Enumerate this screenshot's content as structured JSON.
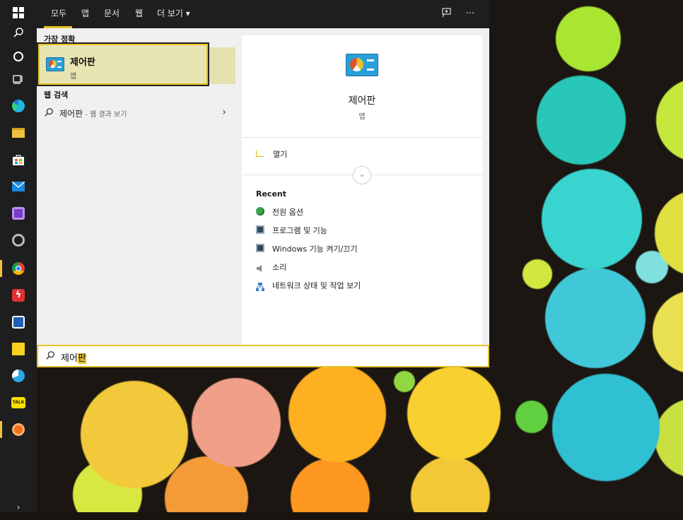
{
  "taskbar": {
    "items": [
      {
        "name": "windows-start",
        "icon": "windows-logo-icon"
      },
      {
        "name": "search",
        "icon": "search-icon"
      },
      {
        "name": "cortana",
        "icon": "cortana-circle-icon"
      },
      {
        "name": "task-view",
        "icon": "task-view-icon"
      },
      {
        "name": "edge",
        "icon": "edge-browser-icon"
      },
      {
        "name": "file-explorer",
        "icon": "folder-icon"
      },
      {
        "name": "store",
        "icon": "store-bag-icon"
      },
      {
        "name": "mail",
        "icon": "mail-envelope-icon"
      },
      {
        "name": "app-purple",
        "icon": "chip-app-icon"
      },
      {
        "name": "app-recorder",
        "icon": "record-circle-icon"
      },
      {
        "name": "chrome",
        "icon": "chrome-browser-icon",
        "active": true
      },
      {
        "name": "app-flash",
        "icon": "lightning-app-icon"
      },
      {
        "name": "app-calendar",
        "icon": "calendar-grid-icon"
      },
      {
        "name": "sticky-notes",
        "icon": "sticky-note-icon"
      },
      {
        "name": "app-bird",
        "icon": "bird-app-icon"
      },
      {
        "name": "kakaotalk",
        "icon": "talk-bubble-icon",
        "label": "TALK"
      },
      {
        "name": "app-location",
        "icon": "location-pin-icon",
        "active": true
      },
      {
        "name": "expand",
        "icon": "chevron-right-icon"
      }
    ],
    "colors": {
      "accent": "#f0c040"
    }
  },
  "navbar": {
    "tabs": [
      {
        "label": "모두",
        "active": true
      },
      {
        "label": "앱"
      },
      {
        "label": "문서"
      },
      {
        "label": "웹"
      },
      {
        "label": "더 보기"
      }
    ],
    "more_caret": "▾",
    "feedback_icon": "feedback-person-icon",
    "more_options_icon": "ellipsis-icon",
    "more_options_glyph": "···"
  },
  "left": {
    "best_match_label": "가장 정확",
    "best_match": {
      "title": "제어판",
      "subtitle": "앱",
      "icon": "control-panel-icon"
    },
    "web_search_label": "웹 검색",
    "web_result": {
      "query": "제어판",
      "suffix": " - 웹 결과 보기",
      "icon": "search-icon",
      "chevron": "›"
    }
  },
  "right": {
    "title": "제어판",
    "subtitle": "앱",
    "open_label": "열기",
    "expand_glyph": "⌄",
    "recent_header": "Recent",
    "recent": [
      {
        "label": "전원 옵션",
        "icon": "power-options-icon"
      },
      {
        "label": "프로그램 및 기능",
        "icon": "programs-features-icon"
      },
      {
        "label": "Windows 기능 켜기/끄기",
        "icon": "windows-features-icon"
      },
      {
        "label": "소리",
        "icon": "speaker-icon"
      },
      {
        "label": "네트워크 상태 및 작업 보기",
        "icon": "network-icon"
      }
    ]
  },
  "search": {
    "typed_prefix": "제어",
    "typed_highlight": "판",
    "icon": "search-icon",
    "glyph": "⚲"
  },
  "colors": {
    "accent": "#e6c229",
    "nav_bg": "#1f1f1f",
    "panel_bg": "#f0f0f0"
  }
}
